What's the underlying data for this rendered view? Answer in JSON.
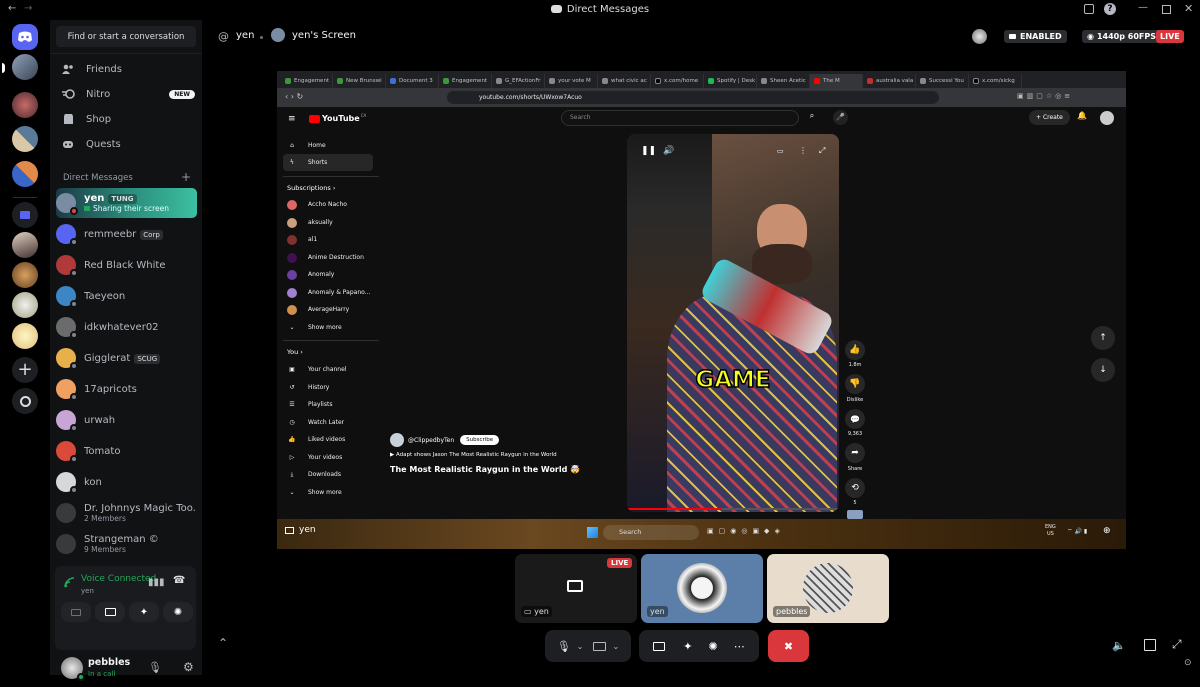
{
  "titlebar": {
    "title": "Direct Messages"
  },
  "sidebar": {
    "search_placeholder": "Find or start a conversation",
    "nav": [
      {
        "label": "Friends",
        "icon": "friends-icon"
      },
      {
        "label": "Nitro",
        "icon": "nitro-icon",
        "badge": "NEW"
      },
      {
        "label": "Shop",
        "icon": "shop-icon"
      },
      {
        "label": "Quests",
        "icon": "quests-icon"
      }
    ],
    "dm_header": "Direct Messages",
    "dms": [
      {
        "name": "yen",
        "tag": "TUNG",
        "status": "Sharing their screen",
        "color": "#7a8ca3",
        "active": true
      },
      {
        "name": "remmeebr",
        "tag": "Corp",
        "color": "#5865f2"
      },
      {
        "name": "Red Black White",
        "color": "#b03a3a"
      },
      {
        "name": "Taeyeon",
        "color": "#3d86c6"
      },
      {
        "name": "idkwhatever02",
        "color": "#6b6b6b"
      },
      {
        "name": "Gigglerat",
        "tag": "SCUG",
        "color": "#e8b04a"
      },
      {
        "name": "17apricots",
        "color": "#f0a060"
      },
      {
        "name": "urwah",
        "color": "#c7a6d6"
      },
      {
        "name": "Tomato",
        "color": "#d94a3a"
      },
      {
        "name": "kon",
        "color": "#d8d8d8"
      },
      {
        "name": "Dr. Johnnys Magic Too...",
        "sub": "2 Members",
        "color": "#3a3a3a"
      },
      {
        "name": "Strangeman ©",
        "sub": "9 Members",
        "color": "#3a3a3a"
      }
    ],
    "voice": {
      "title": "Voice Connected",
      "channel": "yen"
    },
    "user": {
      "name": "pebbles",
      "status": "In a call"
    }
  },
  "header": {
    "at": "@",
    "user": "yen",
    "screen_label": "yen's Screen",
    "enabled": "ENABLED",
    "quality": "1440p 60FPS",
    "live": "LIVE"
  },
  "stream": {
    "tabs": [
      "Engagement",
      "New Brunswi",
      "Document 3",
      "Engagement",
      "G_EFActionFr",
      "your vote M",
      "what civic ac",
      "x.com/home",
      "Spotify | Desk",
      "Sheen Acetic",
      "The M",
      "australia vala",
      "Successi You",
      "x.com/sickg"
    ],
    "url": "youtube.com/shorts/UWxow7Acuo",
    "yt": {
      "logo": "YouTube",
      "region": "CA",
      "search_placeholder": "Search",
      "create": "Create",
      "nav_top": [
        "Home",
        "Shorts"
      ],
      "subs_header": "Subscriptions",
      "subs": [
        "Accho Nacho",
        "aksually",
        "al1",
        "Anime Destruction",
        "Anomaly",
        "Anomaly & Papano...",
        "AverageHarry"
      ],
      "show_more": "Show more",
      "you_header": "You",
      "you_items": [
        "Your channel",
        "History",
        "Playlists",
        "Watch Later",
        "Liked videos",
        "Your videos",
        "Downloads"
      ],
      "show_more2": "Show more",
      "channel": "@ClippedbyTen",
      "subscribe": "Subscribe",
      "music_line": "Adapt shows Jason The Most Realistic Raygun in the World",
      "video_title": "The Most Realistic Raygun in the World 🤯",
      "caption": "GAME",
      "likes": "1.8m",
      "dislike": "Dislike",
      "comments": "9,363",
      "share": "Share",
      "remix": "5"
    },
    "taskbar_search": "Search",
    "tray": {
      "lang": "ENG",
      "region": "US"
    },
    "stream_label": "yen"
  },
  "participants": [
    {
      "name": "yen",
      "live": "LIVE"
    },
    {
      "name": "yen"
    },
    {
      "name": "pebbles"
    }
  ]
}
